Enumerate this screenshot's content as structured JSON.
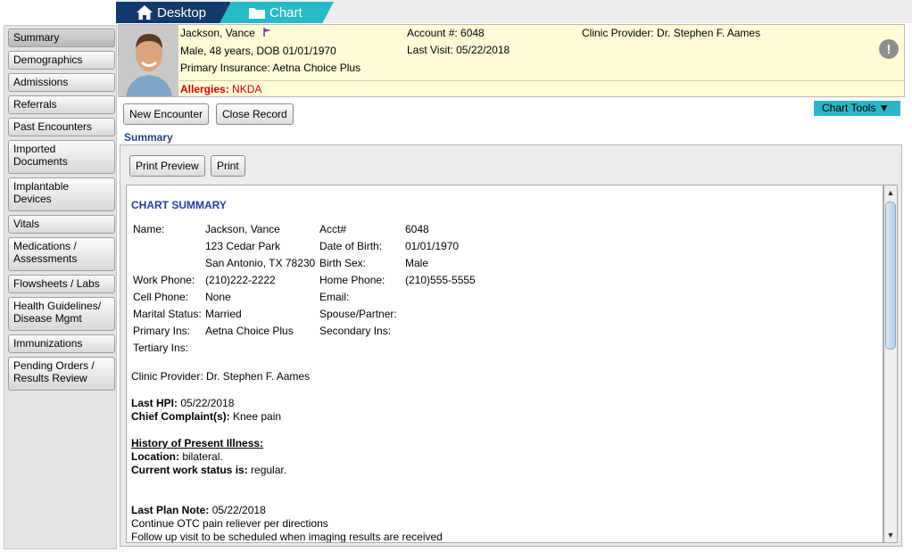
{
  "tabs": {
    "desktop": "Desktop",
    "chart": "Chart"
  },
  "sidebar": [
    {
      "label": "Summary",
      "name": "sidebar-item-summary"
    },
    {
      "label": "Demographics",
      "name": "sidebar-item-demographics"
    },
    {
      "label": "Admissions",
      "name": "sidebar-item-admissions"
    },
    {
      "label": "Referrals",
      "name": "sidebar-item-referrals"
    },
    {
      "label": "Past Encounters",
      "name": "sidebar-item-past-encounters"
    },
    {
      "label": "Imported Documents",
      "name": "sidebar-item-imported-documents"
    },
    {
      "label": "Implantable Devices",
      "name": "sidebar-item-implantable-devices"
    },
    {
      "label": "Vitals",
      "name": "sidebar-item-vitals"
    },
    {
      "label": "Medications / Assessments",
      "name": "sidebar-item-medications"
    },
    {
      "label": "Flowsheets / Labs",
      "name": "sidebar-item-flowsheets"
    },
    {
      "label": "Health Guidelines/ Disease Mgmt",
      "name": "sidebar-item-health-guidelines"
    },
    {
      "label": "Immunizations",
      "name": "sidebar-item-immunizations"
    },
    {
      "label": "Pending Orders / Results Review",
      "name": "sidebar-item-pending-orders"
    }
  ],
  "banner": {
    "patient_name": "Jackson, Vance",
    "demographics": "Male, 48 years, DOB 01/01/1970",
    "primary_insurance": "Primary Insurance: Aetna Choice Plus",
    "account": "Account #: 6048",
    "last_visit": "Last Visit: 05/22/2018",
    "clinic_provider": "Clinic Provider: Dr. Stephen F. Aames",
    "allergies_label": "Allergies:",
    "allergies_value": "NKDA",
    "alert_glyph": "!"
  },
  "toolbar": {
    "new_encounter": "New Encounter",
    "close_record": "Close Record",
    "chart_tools": "Chart Tools ▼"
  },
  "section": {
    "label": "Summary",
    "print_preview": "Print Preview",
    "print": "Print"
  },
  "summary": {
    "title": "CHART SUMMARY",
    "fields": {
      "name_label": "Name:",
      "name_value": "Jackson, Vance",
      "address_line1": "123 Cedar Park",
      "address_line2": "San Antonio, TX 78230",
      "acct_label": "Acct#",
      "acct_value": "6048",
      "dob_label": "Date of Birth:",
      "dob_value": "01/01/1970",
      "sex_label": "Birth Sex:",
      "sex_value": "Male",
      "work_phone_label": "Work Phone:",
      "work_phone_value": "(210)222-2222",
      "home_phone_label": "Home Phone:",
      "home_phone_value": "(210)555-5555",
      "cell_phone_label": "Cell Phone:",
      "cell_phone_value": "None",
      "email_label": "Email:",
      "marital_label": "Marital Status:",
      "marital_value": "Married",
      "spouse_label": "Spouse/Partner:",
      "primary_ins_label": "Primary Ins:",
      "primary_ins_value": "Aetna Choice Plus",
      "secondary_ins_label": "Secondary Ins:",
      "tertiary_ins_label": "Tertiary Ins:"
    },
    "clinic_provider": "Clinic Provider: Dr. Stephen F. Aames",
    "last_hpi_label": "Last HPI:",
    "last_hpi_value": " 05/22/2018",
    "chief_complaint_label": "Chief Complaint(s):",
    "chief_complaint_value": " Knee pain",
    "hpi_heading": "History of Present Illness:",
    "location_label": "Location:",
    "location_value": " bilateral.",
    "work_status_label": "Current work status is:",
    "work_status_value": " regular.",
    "last_plan_label": "Last Plan Note:",
    "last_plan_value": " 05/22/2018",
    "plan_line1": "Continue OTC pain reliever per directions",
    "plan_line2": "Follow up visit to be scheduled when imaging results are received"
  },
  "icons": {
    "home": "home-icon",
    "folder": "folder-icon",
    "flag": "flag-icon",
    "alert": "alert-icon"
  }
}
